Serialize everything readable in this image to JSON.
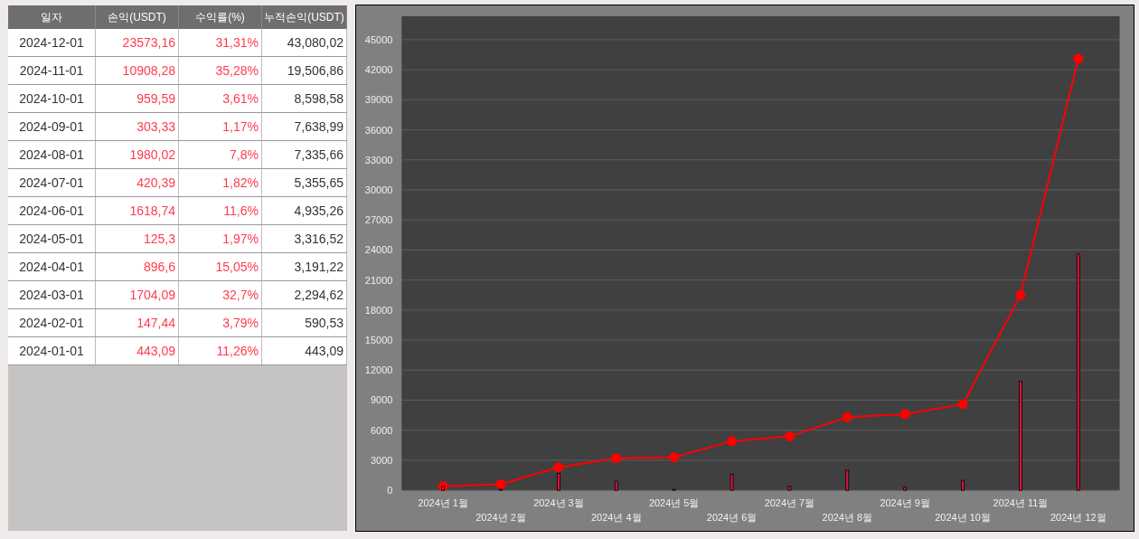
{
  "table": {
    "columns": [
      "일자",
      "손익(USDT)",
      "수익률(%)",
      "누적손익(USDT)"
    ],
    "rows": [
      [
        "2024-12-01",
        "23573,16",
        "31,31%",
        "43,080,02"
      ],
      [
        "2024-11-01",
        "10908,28",
        "35,28%",
        "19,506,86"
      ],
      [
        "2024-10-01",
        "959,59",
        "3,61%",
        "8,598,58"
      ],
      [
        "2024-09-01",
        "303,33",
        "1,17%",
        "7,638,99"
      ],
      [
        "2024-08-01",
        "1980,02",
        "7,8%",
        "7,335,66"
      ],
      [
        "2024-07-01",
        "420,39",
        "1,82%",
        "5,355,65"
      ],
      [
        "2024-06-01",
        "1618,74",
        "11,6%",
        "4,935,26"
      ],
      [
        "2024-05-01",
        "125,3",
        "1,97%",
        "3,316,52"
      ],
      [
        "2024-04-01",
        "896,6",
        "15,05%",
        "3,191,22"
      ],
      [
        "2024-03-01",
        "1704,09",
        "32,7%",
        "2,294,62"
      ],
      [
        "2024-02-01",
        "147,44",
        "3,79%",
        "590,53"
      ],
      [
        "2024-01-01",
        "443,09",
        "11,26%",
        "443,09"
      ]
    ]
  },
  "chart": {
    "chart_data": {
      "type": "bar",
      "categories": [
        "2024년 1월",
        "2024년 2월",
        "2024년 3월",
        "2024년 4월",
        "2024년 5월",
        "2024년 6월",
        "2024년 7월",
        "2024년 8월",
        "2024년 9월",
        "2024년 10월",
        "2024년 11월",
        "2024년 12월"
      ],
      "series": [
        {
          "color": "#dc143c",
          "values": [
            400,
            100,
            1700,
            900,
            100,
            1600,
            400,
            2000,
            300,
            1000,
            10900,
            23600
          ]
        },
        {
          "type": "line",
          "color": "#ff0000",
          "marker": true,
          "values": [
            400,
            600,
            2300,
            3200,
            3300,
            4900,
            5400,
            7300,
            7600,
            8600,
            19500,
            43100
          ]
        }
      ],
      "grid": true,
      "ylim": [
        0,
        47340
      ],
      "yticks": [
        0,
        3000,
        6000,
        9000,
        12000,
        15000,
        18000,
        21000,
        24000,
        27000,
        30000,
        33000,
        36000,
        39000,
        42000,
        45000
      ]
    }
  }
}
